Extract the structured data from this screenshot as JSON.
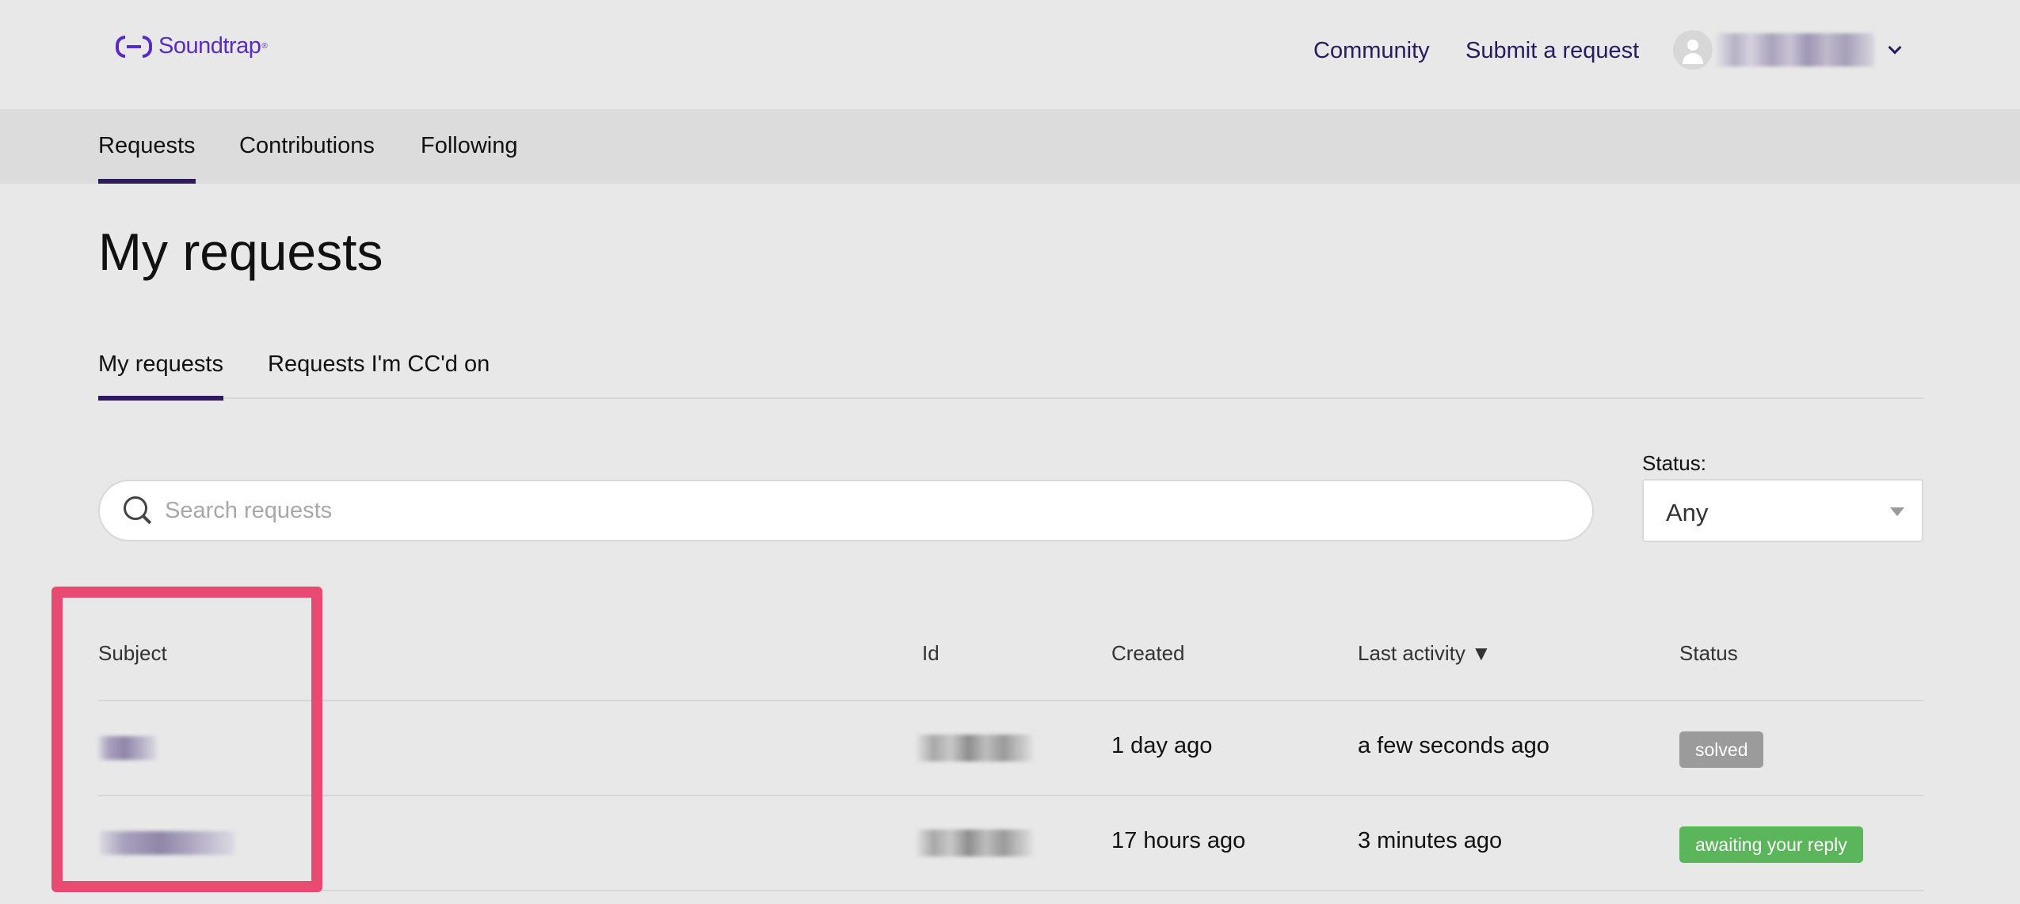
{
  "header": {
    "logo_text": "Soundtrap",
    "logo_reg": "®",
    "links": [
      "Community",
      "Submit a request"
    ],
    "user_icon": "user-avatar-icon",
    "chevron_icon": "chevron-down-icon"
  },
  "subnav": {
    "items": [
      "Requests",
      "Contributions",
      "Following"
    ],
    "active": "Requests"
  },
  "page": {
    "title": "My requests"
  },
  "tabs": {
    "items": [
      "My requests",
      "Requests I'm CC'd on"
    ],
    "active": "My requests"
  },
  "search": {
    "placeholder": "Search requests",
    "icon": "search-icon"
  },
  "status_filter": {
    "label": "Status:",
    "value": "Any"
  },
  "table": {
    "columns": [
      "Subject",
      "Id",
      "Created",
      "Last activity ▼",
      "Status"
    ],
    "rows": [
      {
        "created": "1 day ago",
        "last_activity": "a few seconds ago",
        "status": "solved"
      },
      {
        "created": "17 hours ago",
        "last_activity": "3 minutes ago",
        "status": "awaiting your reply"
      }
    ]
  },
  "colors": {
    "brand": "#5a2bc4",
    "nav_accent": "#2e1a5c",
    "status_solved": "#9b9b9b",
    "status_awaiting": "#5bb55b",
    "highlight": "#e84a72"
  }
}
